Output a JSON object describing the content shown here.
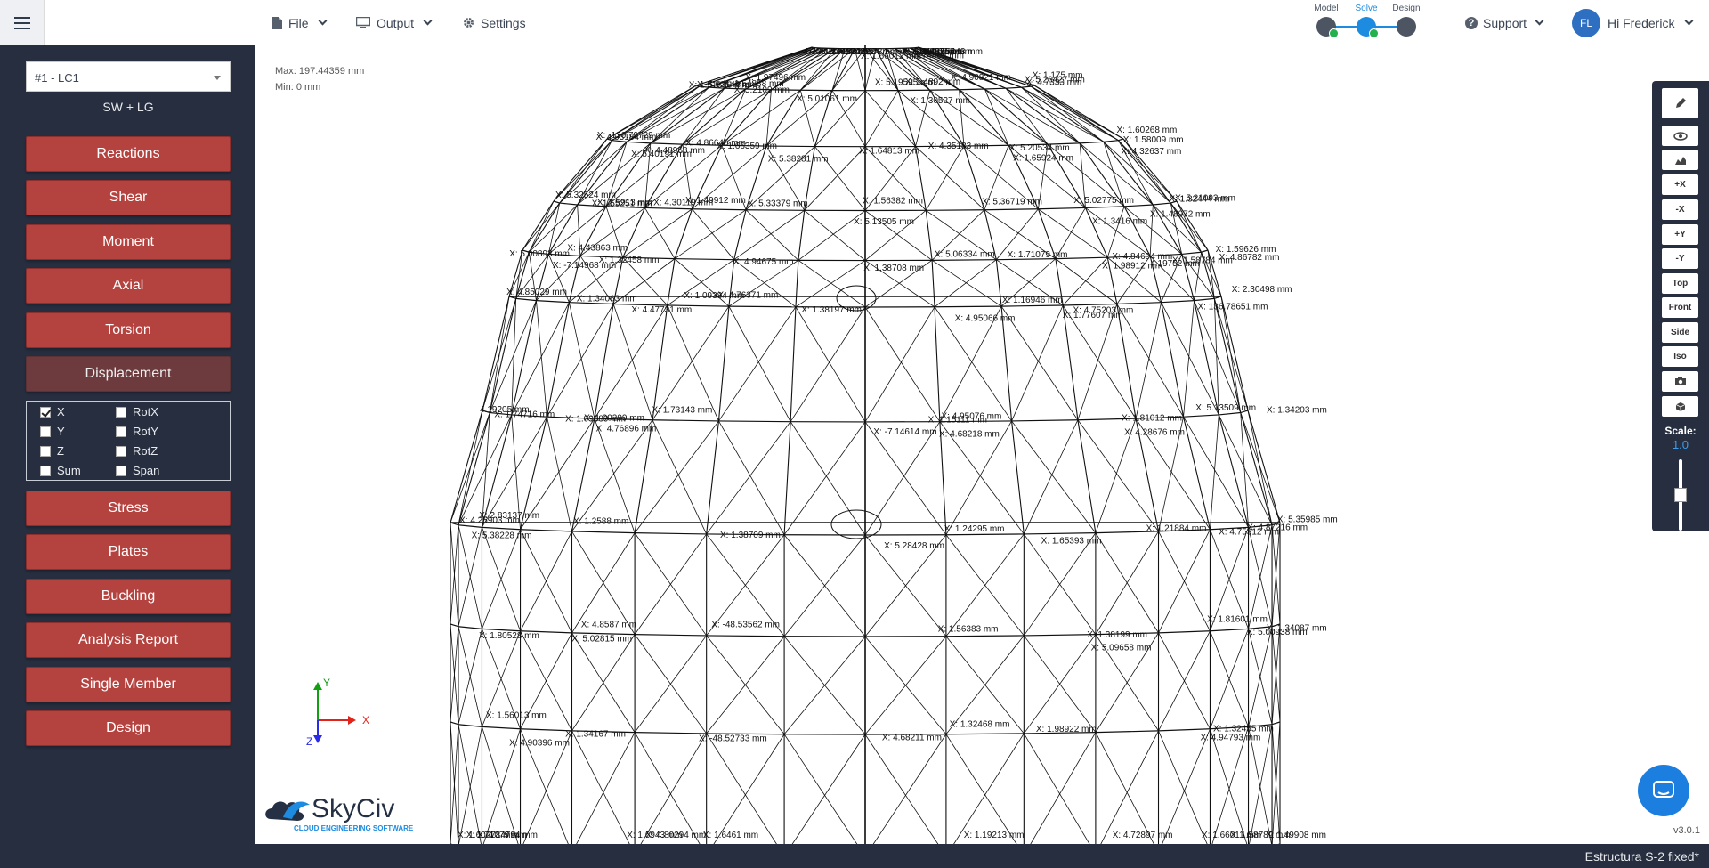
{
  "topbar": {
    "menu_icon": "hamburger-icon",
    "file_label": "File",
    "output_label": "Output",
    "settings_label": "Settings",
    "modes": [
      {
        "label": "Model",
        "icon": "model-icon",
        "active": false
      },
      {
        "label": "Solve",
        "icon": "cloud-icon",
        "active": true
      },
      {
        "label": "Design",
        "icon": "design-icon",
        "active": false
      }
    ],
    "support_label": "Support",
    "user_initials": "FL",
    "user_greeting": "Hi Frederick"
  },
  "sidebar": {
    "load_case": "#1 - LC1",
    "load_combo": "SW + LG",
    "buttons": [
      {
        "label": "Reactions"
      },
      {
        "label": "Shear"
      },
      {
        "label": "Moment"
      },
      {
        "label": "Axial"
      },
      {
        "label": "Torsion"
      },
      {
        "label": "Displacement",
        "selected": true
      },
      {
        "label": "Stress"
      },
      {
        "label": "Plates"
      },
      {
        "label": "Buckling"
      },
      {
        "label": "Analysis Report"
      },
      {
        "label": "Single Member"
      },
      {
        "label": "Design"
      }
    ],
    "displacement_options": [
      {
        "label": "X",
        "checked": true
      },
      {
        "label": "RotX",
        "checked": false
      },
      {
        "label": "Y",
        "checked": false
      },
      {
        "label": "RotY",
        "checked": false
      },
      {
        "label": "Z",
        "checked": false
      },
      {
        "label": "RotZ",
        "checked": false
      },
      {
        "label": "Sum",
        "checked": false
      },
      {
        "label": "Span",
        "checked": false
      }
    ]
  },
  "canvas": {
    "max_label": "Max: 197.44359 mm",
    "min_label": "Min: 0 mm",
    "axes": {
      "x": "X",
      "y": "Y",
      "z": "Z"
    },
    "axis_colors": {
      "x": "#e2231a",
      "y": "#12a012",
      "z": "#2a2ae8"
    },
    "node_labels": [
      "X: 5.06333 mm",
      "X: 4.93224 mm",
      "4.85045 mm",
      "4.74468 mm",
      "X: 5.2109 mm",
      "X: 5.19595 mm",
      "X: 5.26427 mm",
      "X: 5.40191 mm",
      "X: 5.38281 mm",
      "X: 5.20534 mm",
      "X: 5.32524 mm",
      "X: 5.33379 mm",
      "X: 5.36719 mm",
      "X: 5.21093 mm",
      "X: 4.43863 mm",
      "X: 5.06334 mm",
      "4.19752 mm",
      "X: 4.85029 mm",
      "X: 4.76371 mm",
      "X: 4.75203 mm",
      "4.19205 mm",
      "X: 4.76896 mm",
      "X: 4.95076 mm",
      "X: 5.13509 mm",
      "X: 5.38228 mm",
      "X: 5.28428 mm",
      "X: 4.75312 mm",
      "X: 5.35985 mm",
      "X: 5.02815 mm",
      "X: 5.09658 mm",
      "X: 5.00938 mm",
      "X: 4.90396 mm",
      "X: 4.68211 mm",
      "X: 4.94793 mm",
      "X: 4.84794 mm",
      "X: 4.80294 mm",
      "X: 4.72897 mm",
      "4.75802 mm",
      "X: 4.25893 mm",
      "X: 4.26067 mm",
      "X: 5.04482 mm",
      "X: 5.02149 mm",
      "X: 5.01061 mm",
      "X: 4.90821 mm",
      "X: 4.93184 mm",
      "X: 4.86645 mm",
      "X: 4.35183 mm",
      "X: 4.32637 mm",
      "X: 4.30119 mm",
      "X: 5.13505 mm",
      "X: 5.02775 mm",
      "X: 5.00893 mm",
      "X: 4.94675 mm",
      "X: 4.84694 mm",
      "X: 4.86782 mm",
      "X: 4.47731 mm",
      "X: 4.95066 mm",
      "X: 136.78651 mm",
      "X: 1.09389 mm",
      "X: -7.14614 mm",
      "X: 4.28676 mm",
      "X: 4.25903 mm",
      "X: 1.38709 mm",
      "X: 1.65393 mm",
      "X: 4.87216 mm",
      "X: 4.8587 mm",
      "X: 1.56383 mm",
      "X: 1.81601 mm",
      "X: 1.56013 mm",
      "X: -48.52733 mm",
      "X: 1.98922 mm",
      "X: 1.60271 mm",
      "X: 1.6943 mm",
      "X: 1.19213 mm",
      "X: 1.66011 mm",
      "X: 4.34452 mm",
      "X: -174.53734 mm",
      "X: 1.49757 mm",
      "X: 1.51888 mm",
      "X: 1.97496 mm",
      "X: 1.30527 mm",
      "X: 4.7333 mm",
      "X: 4.48968 mm",
      "X: 1.64813 mm",
      "X: 1.58009 mm",
      "X: 1.55251 mm",
      "X: 1.49912 mm",
      "X: 1.3416 mm",
      "X: 1.32444 mm",
      "X: 1.32458 mm",
      "X: 1.71079 mm",
      "X: 1.58784 mm",
      "X: 1.34063 mm",
      "X: 1.38197 mm",
      "X: 1.77607 mm",
      "X: 1.74716 mm",
      "X: 1.73143 mm",
      "X: 4.68218 mm",
      "X: 1.34203 mm",
      "X: 1.2588 mm",
      "X: 1.24295 mm",
      "X: 1.21884 mm",
      "X: 1.80528 mm",
      "X: -48.53562 mm",
      "X: 1.38199 mm",
      "X: 1.34087 mm",
      "X: 1.34167 mm",
      "X: 1.32468 mm",
      "X: 1.32455 mm",
      "X: 1.71079 mm",
      "X: 1.6461 mm",
      "X: 1.58789 mm",
      "X: 1.49908 mm",
      "X: 1.66012 mm",
      "X: 1.58005 mm",
      "X: 1.55243 mm",
      "X: 1.54888 mm",
      "X: 1.4892 mm",
      "X: 1.175 mm",
      "X: -136.79729 mm",
      "X: 1.66359 mm",
      "X: 1.65924 mm",
      "X: 1.60268 mm",
      "X: 1.5913 mm",
      "X: 1.56382 mm",
      "X: 1.48972 mm",
      "X: -7.14968 mm",
      "X: 1.38708 mm",
      "X: 1.98912 mm",
      "X: 1.59626 mm",
      "X: 1.09384 mm",
      "X: 1.16946 mm",
      "X: 2.30498 mm",
      "X: 1.09299 mm",
      "X: 1.15111 mm",
      "X: 1.81012 mm",
      "X: 2.83137 mm"
    ]
  },
  "toolbar": {
    "buttons": [
      {
        "label": "",
        "icon": "pencil-icon"
      },
      {
        "label": "",
        "icon": "eye-icon"
      },
      {
        "label": "",
        "icon": "area-chart-icon"
      },
      {
        "label": "+X"
      },
      {
        "label": "-X"
      },
      {
        "label": "+Y"
      },
      {
        "label": "-Y"
      },
      {
        "label": "Top"
      },
      {
        "label": "Front"
      },
      {
        "label": "Side"
      },
      {
        "label": "Iso"
      },
      {
        "label": "",
        "icon": "camera-icon"
      },
      {
        "label": "",
        "icon": "cube-icon"
      }
    ],
    "scale_label": "Scale:",
    "scale_value": "1.0"
  },
  "logo": {
    "name": "SkyCiv",
    "tagline": "CLOUD ENGINEERING SOFTWARE"
  },
  "version": "v3.0.1",
  "status": {
    "filename": "Estructura S-2 fixed*"
  }
}
